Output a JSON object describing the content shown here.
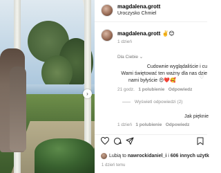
{
  "post": {
    "username": "magdalena.grott",
    "location": "Uroczysko Chmiel",
    "caption_emoji": "✌️😊",
    "caption_time": "1 dzień"
  },
  "dla_ciebie": "Dla Ciebie ⌄",
  "comment": {
    "line1": "Cudownie wyglądaliście i cu",
    "line2": "Wami świętować ten ważny dla nas dzie",
    "line3": "nami byłyście 😍❤️🥰",
    "time": "21 godz.",
    "likes": "1 polubienie",
    "reply": "Odpowiedz"
  },
  "view_replies": "Wyświetl odpowiedzi (2)",
  "comment2": {
    "text": "Jak pięknie",
    "time": "1 dzień",
    "likes": "1 polubienie",
    "reply": "Odpowiedz"
  },
  "likes_line": {
    "prefix": "Lubią to ",
    "user": "nawrockidaniel_i",
    "mid": " i ",
    "others": "606 innych użytk"
  },
  "date": "1 dzień temu",
  "icons": {
    "heart": "heart-icon",
    "comment": "comment-icon",
    "share": "share-icon",
    "bookmark": "bookmark-icon",
    "next": "chevron-right-icon"
  }
}
